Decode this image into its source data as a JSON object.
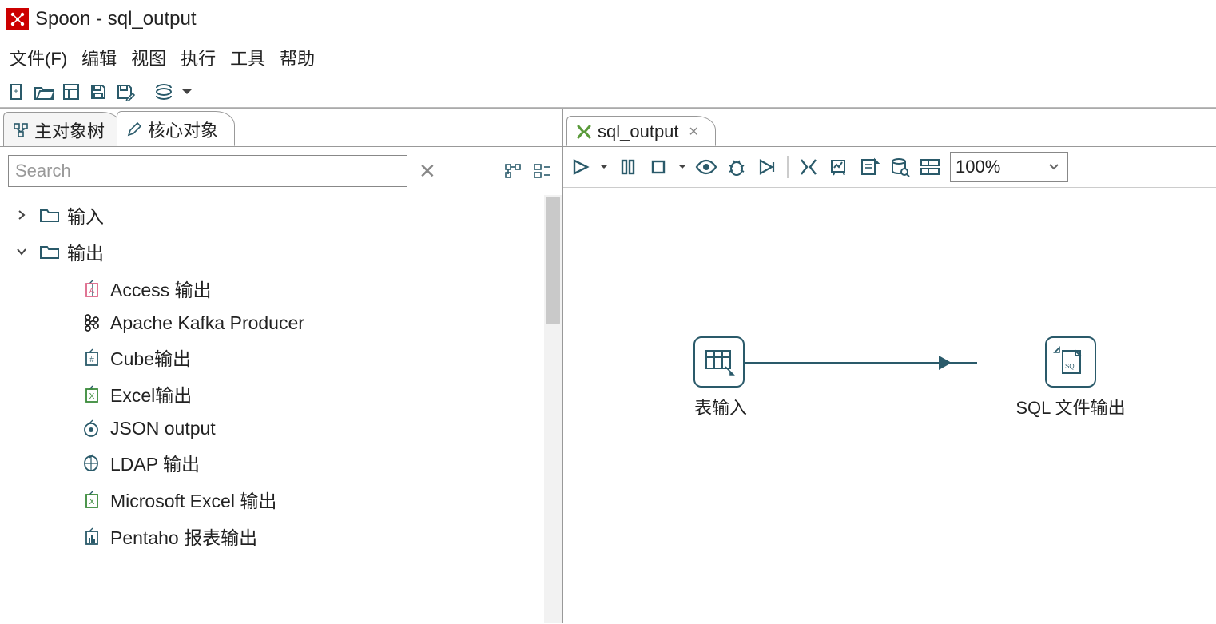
{
  "window": {
    "title": "Spoon - sql_output"
  },
  "menu": {
    "file": "文件(F)",
    "edit": "编辑",
    "view": "视图",
    "run": "执行",
    "tools": "工具",
    "help": "帮助"
  },
  "leftTabs": {
    "main_tree": "主对象树",
    "core_objects": "核心对象"
  },
  "search": {
    "placeholder": "Search"
  },
  "tree": {
    "input_folder": "输入",
    "output_folder": "输出",
    "output_items": {
      "access": "Access 输出",
      "kafka": "Apache Kafka Producer",
      "cube": "Cube输出",
      "excel": "Excel输出",
      "json": "JSON output",
      "ldap": "LDAP 输出",
      "msexcel": "Microsoft Excel 输出",
      "pentaho": "Pentaho 报表输出"
    }
  },
  "rightTab": {
    "label": "sql_output"
  },
  "zoom": {
    "value": "100%"
  },
  "canvas": {
    "node1": "表输入",
    "node2": "SQL 文件输出"
  }
}
